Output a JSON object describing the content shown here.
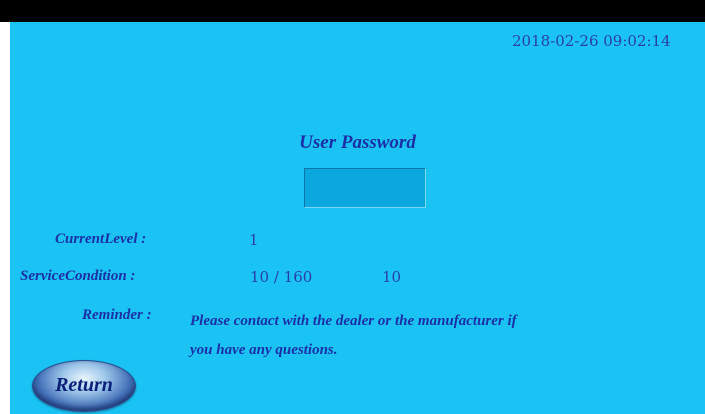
{
  "status_bar": {
    "datetime": "2018-02-26 09:02:14"
  },
  "title": "User Password",
  "password_field": {
    "value": "",
    "placeholder": ""
  },
  "current_level": {
    "label": "CurrentLevel :",
    "value": "1"
  },
  "service_condition": {
    "label": "ServiceCondition :",
    "value": "10 / 160",
    "value2": "10"
  },
  "reminder": {
    "label": "Reminder :",
    "line1": "Please contact with the dealer or the manufacturer if",
    "line2": "you have any questions."
  },
  "return_button": {
    "label": "Return"
  },
  "colors": {
    "background": "#1ac3f4",
    "text": "#1b2fa8",
    "top_bar": "#000000"
  }
}
